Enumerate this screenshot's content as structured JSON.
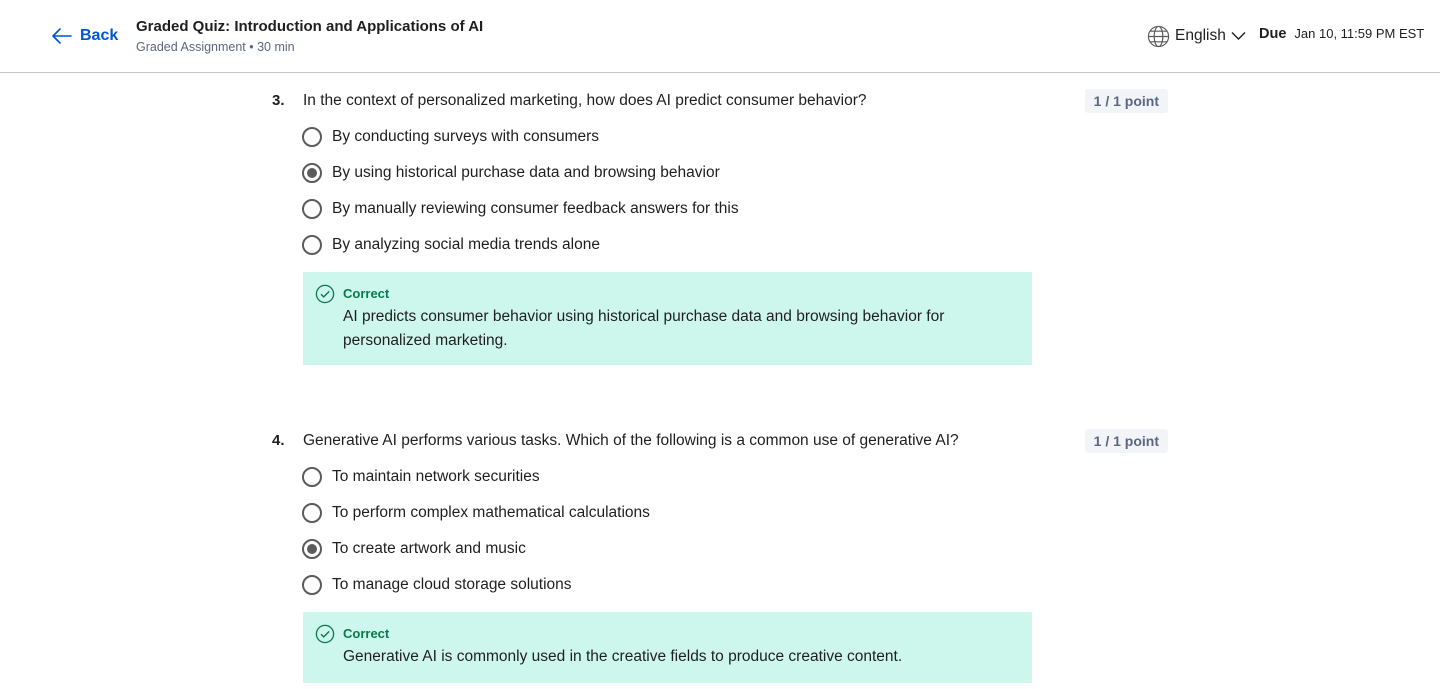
{
  "header": {
    "back_label": "Back",
    "title": "Graded Quiz: Introduction and Applications of AI",
    "subtitle": "Graded Assignment • 30 min",
    "language": "English",
    "due_label": "Due",
    "due_date": "Jan 10, 11:59 PM EST"
  },
  "questions": [
    {
      "number": "3.",
      "text": "In the context of personalized marketing, how does AI predict consumer behavior?",
      "points": "1 / 1 point",
      "selected_index": 1,
      "options": [
        "By conducting surveys with consumers",
        "By using historical purchase data and browsing behavior",
        "By manually reviewing consumer feedback answers for this",
        "By analyzing social media trends alone"
      ],
      "feedback": {
        "title": "Correct",
        "text": "AI predicts consumer behavior using historical purchase data and browsing behavior for personalized marketing."
      }
    },
    {
      "number": "4.",
      "text": "Generative AI performs various tasks. Which of the following is a common use of generative AI?",
      "points": "1 / 1 point",
      "selected_index": 2,
      "options": [
        "To maintain network securities",
        "To perform complex mathematical calculations",
        "To create artwork and music",
        "To manage cloud storage solutions"
      ],
      "feedback": {
        "title": "Correct",
        "text": "Generative AI is commonly used in the creative fields to produce creative content."
      }
    }
  ],
  "colors": {
    "accent": "#0056d2",
    "correct_bg": "#cdf7ec",
    "correct_text": "#0b7a4b",
    "muted_text": "#5b6780"
  }
}
